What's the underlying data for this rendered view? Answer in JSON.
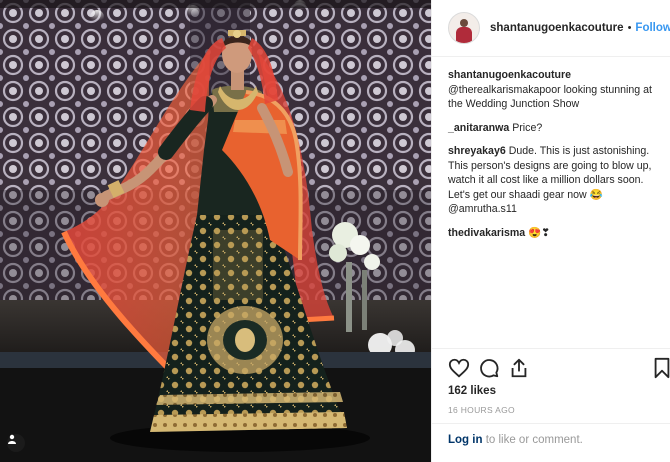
{
  "post": {
    "username": "shantanugoenkacouture",
    "separator": "•",
    "follow_label": "Follow"
  },
  "comments": [
    {
      "user": "shantanugoenkacouture",
      "text": "@therealkarismakapoor looking stunning at the Wedding Junction Show"
    },
    {
      "user": "_anitaranwa",
      "text": "Price?"
    },
    {
      "user": "shreyakay6",
      "text": "Dude. This is just astonishing. This person's designs are going to blow up, watch it all cost like a million dollars soon. Let's get our shaadi gear now 😂 @amrutha.s11"
    },
    {
      "user": "thedivakarisma",
      "text": "😍❣"
    }
  ],
  "actions": {
    "like_icon": "heart-icon",
    "comment_icon": "comment-icon",
    "share_icon": "share-icon",
    "save_icon": "bookmark-icon"
  },
  "likes": "162 likes",
  "timestamp": "16 HOURS AGO",
  "login": {
    "link_label": "Log in",
    "rest_text": " to like or comment."
  },
  "colors": {
    "link_blue": "#3897f0",
    "login_blue": "#003569",
    "muted": "#999999",
    "border": "#efefef"
  }
}
